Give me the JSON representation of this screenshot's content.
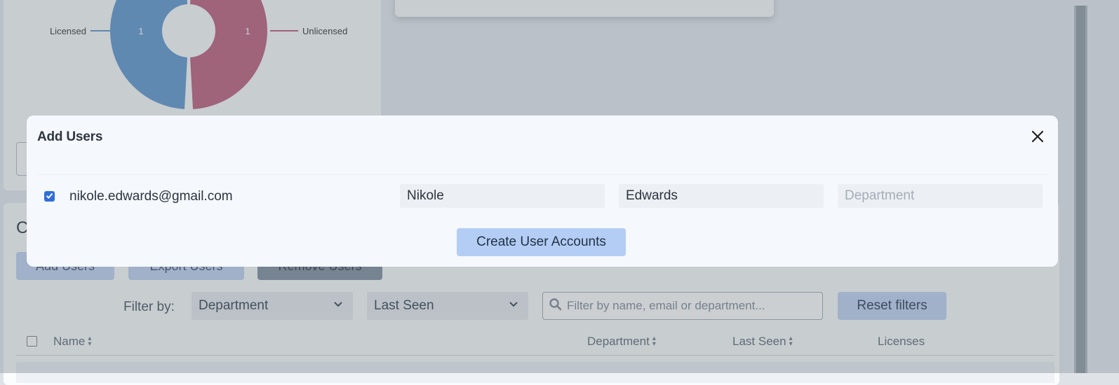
{
  "chart": {
    "label_licensed": "Licensed",
    "label_unlicensed": "Unlicensed",
    "value_licensed": "1",
    "value_unlicensed": "1",
    "color_licensed": "#6a9fd2",
    "color_unlicensed": "#c36a86"
  },
  "list": {
    "title": "C",
    "add_users_label": "Add Users",
    "export_users_label": "Export Users",
    "remove_users_label": "Remove Users",
    "filter_label": "Filter by:",
    "department_select": "Department",
    "last_seen_select": "Last Seen",
    "search_placeholder": "Filter by name, email or department...",
    "reset_filters_label": "Reset filters",
    "columns": {
      "name": "Name",
      "department": "Department",
      "last_seen": "Last Seen",
      "licenses": "Licenses"
    }
  },
  "modal": {
    "title": "Add Users",
    "user": {
      "checked": true,
      "email": "nikole.edwards@gmail.com",
      "first_name": "Nikole",
      "last_name": "Edwards",
      "department_placeholder": "Department"
    },
    "create_label": "Create User Accounts"
  },
  "colors": {
    "accent": "#2f6fd6",
    "primary_button": "#b3cdf5"
  }
}
